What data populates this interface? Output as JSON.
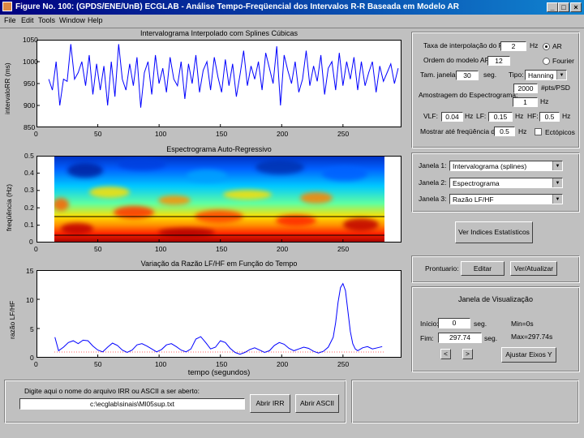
{
  "window": {
    "title": "Figure No. 100: (GPDS/ENE/UnB) ECGLAB - Análise Tempo-Freqüencial dos Intervalos R-R Baseada em Modelo AR",
    "controls": [
      "_",
      "□",
      "×"
    ]
  },
  "menu": [
    {
      "label": "File"
    },
    {
      "label": "Edit"
    },
    {
      "label": "Tools"
    },
    {
      "label": "Window"
    },
    {
      "label": "Help"
    }
  ],
  "plot1": {
    "title": "Intervalograma Interpolado com Splines Cúbicas",
    "ylabel": "intervaloRR (ms)",
    "yticks": [
      "1050",
      "1000",
      "950",
      "900",
      "850"
    ],
    "xticks": [
      "0",
      "50",
      "100",
      "150",
      "200",
      "250"
    ]
  },
  "plot2": {
    "title": "Espectrograma Auto-Regressivo",
    "ylabel": "freqüência (Hz)",
    "yticks": [
      "0.5",
      "0.4",
      "0.3",
      "0.2",
      "0.1",
      "0"
    ],
    "xticks": [
      "0",
      "50",
      "100",
      "150",
      "200",
      "250"
    ]
  },
  "plot3": {
    "title": "Variação da Razão LF/HF em Função do Tempo",
    "ylabel": "razão LF/HF",
    "xlabel": "tempo (segundos)",
    "yticks": [
      "15",
      "10",
      "5",
      "0"
    ],
    "xticks": [
      "0",
      "50",
      "100",
      "150",
      "200",
      "250"
    ]
  },
  "chart_data": [
    {
      "type": "line",
      "title": "Intervalograma Interpolado com Splines Cúbicas",
      "ylabel": "intervaloRR (ms)",
      "xlim": [
        0,
        297.74
      ],
      "ylim": [
        850,
        1050
      ],
      "color": "#0000ff",
      "x": [
        10,
        13,
        16,
        19,
        22,
        25,
        28,
        31,
        34,
        37,
        40,
        43,
        46,
        49,
        52,
        55,
        58,
        61,
        64,
        67,
        70,
        73,
        76,
        79,
        82,
        85,
        88,
        91,
        94,
        97,
        100,
        103,
        106,
        109,
        112,
        115,
        118,
        121,
        124,
        127,
        130,
        133,
        136,
        139,
        142,
        145,
        148,
        151,
        154,
        157,
        160,
        163,
        166,
        169,
        172,
        175,
        178,
        181,
        184,
        187,
        190,
        193,
        196,
        199,
        202,
        205,
        208,
        211,
        214,
        217,
        220,
        223,
        226,
        229,
        232,
        235,
        238,
        241,
        244,
        247,
        250,
        253,
        256,
        259,
        262,
        265,
        268,
        271,
        274,
        277,
        280,
        283,
        286,
        289,
        292,
        295
      ],
      "y": [
        960,
        935,
        1000,
        900,
        960,
        955,
        1040,
        960,
        975,
        1000,
        945,
        1015,
        925,
        995,
        935,
        990,
        900,
        1000,
        920,
        1040,
        960,
        935,
        995,
        945,
        1010,
        895,
        975,
        1000,
        925,
        1015,
        950,
        985,
        930,
        1010,
        960,
        945,
        1000,
        915,
        995,
        950,
        1015,
        930,
        980,
        1000,
        935,
        1010,
        965,
        930,
        1005,
        945,
        995,
        920,
        970,
        1025,
        945,
        990,
        960,
        1000,
        935,
        1020,
        985,
        950,
        1035,
        900,
        1015,
        980,
        950,
        1000,
        930,
        960,
        1025,
        945,
        990,
        955,
        1015,
        925,
        985,
        1000,
        935,
        1020,
        945,
        1000,
        960,
        1010,
        935,
        1000,
        945,
        975,
        1000,
        930,
        990,
        955,
        975,
        995,
        950,
        985
      ]
    },
    {
      "type": "heatmap",
      "title": "Espectrograma Auto-Regressivo",
      "ylabel": "freqüência (Hz)",
      "xlim": [
        0,
        297.74
      ],
      "ylim": [
        0,
        0.5
      ],
      "colormap": "jet",
      "band_lines_hz": [
        0.04,
        0.15
      ]
    },
    {
      "type": "line",
      "title": "Variação da Razão LF/HF em Função do Tempo",
      "xlabel": "tempo (segundos)",
      "ylabel": "razão LF/HF",
      "xlim": [
        0,
        297.74
      ],
      "ylim": [
        0,
        15
      ],
      "color": "#0000ff",
      "x": [
        15,
        18,
        22,
        26,
        30,
        34,
        38,
        42,
        46,
        50,
        54,
        58,
        62,
        66,
        70,
        74,
        78,
        82,
        86,
        90,
        94,
        98,
        102,
        106,
        110,
        114,
        118,
        122,
        126,
        130,
        134,
        138,
        142,
        146,
        150,
        154,
        158,
        162,
        166,
        170,
        174,
        178,
        182,
        186,
        190,
        194,
        198,
        202,
        206,
        210,
        214,
        218,
        222,
        226,
        230,
        234,
        238,
        242,
        244,
        246,
        248,
        250,
        252,
        254,
        256,
        258,
        260,
        262,
        266,
        270,
        274,
        278,
        282
      ],
      "y": [
        3.5,
        1.2,
        1.8,
        2.6,
        2.9,
        2.4,
        3.0,
        2.9,
        2.0,
        1.3,
        1.0,
        1.8,
        2.5,
        2.1,
        1.3,
        0.9,
        1.3,
        2.2,
        2.4,
        2.0,
        1.5,
        1.0,
        1.4,
        2.2,
        2.4,
        1.9,
        1.3,
        1.0,
        1.5,
        3.2,
        3.6,
        2.6,
        1.5,
        1.8,
        2.9,
        2.6,
        1.6,
        0.9,
        0.6,
        0.9,
        1.4,
        1.7,
        1.3,
        0.9,
        1.2,
        2.1,
        2.6,
        2.3,
        1.6,
        1.2,
        1.5,
        1.8,
        1.6,
        1.1,
        0.8,
        1.1,
        1.8,
        3.5,
        6.0,
        9.5,
        12.0,
        12.7,
        11.5,
        8.0,
        4.5,
        2.4,
        1.5,
        1.2,
        1.7,
        1.9,
        1.5,
        1.7,
        1.9
      ]
    }
  ],
  "params": {
    "taxa_label": "Taxa de interpolação do RR:",
    "taxa_value": "2",
    "taxa_unit": "Hz",
    "ordem_label": "Ordem do modelo AR:",
    "ordem_value": "12",
    "ar_label": "AR",
    "fourier_label": "Fourier",
    "janela_label": "Tam. janela:",
    "janela_value": "30",
    "janela_unit": "seg.",
    "tipo_label": "Tipo:",
    "tipo_value": "Hanning",
    "amostragem_label": "Amostragem do Espectrograma:",
    "pts_value": "2000",
    "pts_unit": "#pts/PSD",
    "hz_value": "1",
    "hz_unit": "Hz",
    "vlf_label": "VLF:",
    "vlf_value": "0.04",
    "vlf_unit": "Hz",
    "lf_label": "LF:",
    "lf_value": "0.15",
    "lf_unit": "Hz",
    "hf_label": "HF:",
    "hf_value": "0.5",
    "hf_unit": "Hz",
    "mostrar_label": "Mostrar até freqüência de:",
    "mostrar_value": "0.5",
    "mostrar_unit": "Hz",
    "ectopicos_label": "Ectópicos"
  },
  "janelas": {
    "j1_label": "Janela 1:",
    "j1_value": "Intervalograma (splines)",
    "j2_label": "Janela 2:",
    "j2_value": "Espectrograma",
    "j3_label": "Janela 3:",
    "j3_value": "Razão LF/HF"
  },
  "indices_button": "Ver Indices Estatísticos",
  "prontuario": {
    "label": "Prontuario:",
    "editar": "Editar",
    "ver": "Ver/Atualizar"
  },
  "visualizacao": {
    "title": "Janela de Visualização",
    "inicio_label": "Início:",
    "inicio_value": "0",
    "inicio_unit": "seg.",
    "fim_label": "Fim:",
    "fim_value": "297.74",
    "fim_unit": "seg.",
    "min_text": "Min=0s",
    "max_text": "Max=297.74s",
    "prev": "<",
    "next": ">",
    "ajustar": "Ajustar Eixos Y"
  },
  "file_panel": {
    "label": "Digite aqui o nome do arquivo IRR ou ASCII a ser aberto:",
    "path": "c:\\ecglab\\sinais\\Ml05sup.txt",
    "abrir_irr": "Abrir IRR",
    "abrir_ascii": "Abrir ASCII"
  }
}
